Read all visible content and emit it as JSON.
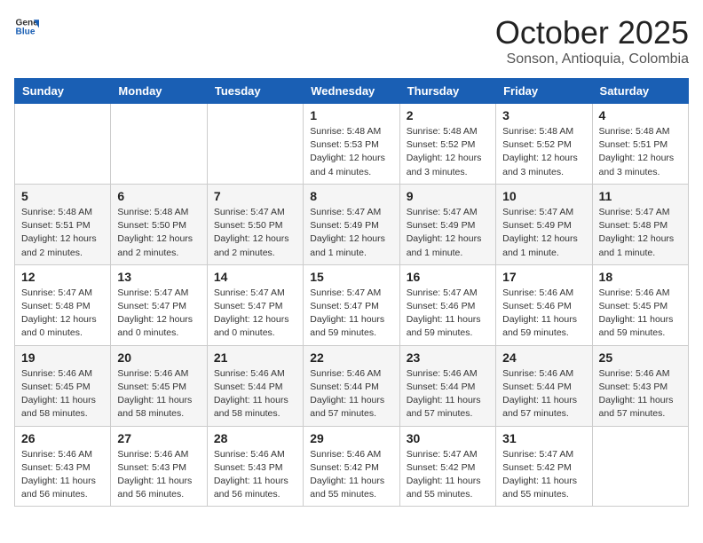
{
  "header": {
    "logo_general": "General",
    "logo_blue": "Blue",
    "title": "October 2025",
    "location": "Sonson, Antioquia, Colombia"
  },
  "days_of_week": [
    "Sunday",
    "Monday",
    "Tuesday",
    "Wednesday",
    "Thursday",
    "Friday",
    "Saturday"
  ],
  "weeks": [
    [
      {
        "day": "",
        "info": ""
      },
      {
        "day": "",
        "info": ""
      },
      {
        "day": "",
        "info": ""
      },
      {
        "day": "1",
        "info": "Sunrise: 5:48 AM\nSunset: 5:53 PM\nDaylight: 12 hours\nand 4 minutes."
      },
      {
        "day": "2",
        "info": "Sunrise: 5:48 AM\nSunset: 5:52 PM\nDaylight: 12 hours\nand 3 minutes."
      },
      {
        "day": "3",
        "info": "Sunrise: 5:48 AM\nSunset: 5:52 PM\nDaylight: 12 hours\nand 3 minutes."
      },
      {
        "day": "4",
        "info": "Sunrise: 5:48 AM\nSunset: 5:51 PM\nDaylight: 12 hours\nand 3 minutes."
      }
    ],
    [
      {
        "day": "5",
        "info": "Sunrise: 5:48 AM\nSunset: 5:51 PM\nDaylight: 12 hours\nand 2 minutes."
      },
      {
        "day": "6",
        "info": "Sunrise: 5:48 AM\nSunset: 5:50 PM\nDaylight: 12 hours\nand 2 minutes."
      },
      {
        "day": "7",
        "info": "Sunrise: 5:47 AM\nSunset: 5:50 PM\nDaylight: 12 hours\nand 2 minutes."
      },
      {
        "day": "8",
        "info": "Sunrise: 5:47 AM\nSunset: 5:49 PM\nDaylight: 12 hours\nand 1 minute."
      },
      {
        "day": "9",
        "info": "Sunrise: 5:47 AM\nSunset: 5:49 PM\nDaylight: 12 hours\nand 1 minute."
      },
      {
        "day": "10",
        "info": "Sunrise: 5:47 AM\nSunset: 5:49 PM\nDaylight: 12 hours\nand 1 minute."
      },
      {
        "day": "11",
        "info": "Sunrise: 5:47 AM\nSunset: 5:48 PM\nDaylight: 12 hours\nand 1 minute."
      }
    ],
    [
      {
        "day": "12",
        "info": "Sunrise: 5:47 AM\nSunset: 5:48 PM\nDaylight: 12 hours\nand 0 minutes."
      },
      {
        "day": "13",
        "info": "Sunrise: 5:47 AM\nSunset: 5:47 PM\nDaylight: 12 hours\nand 0 minutes."
      },
      {
        "day": "14",
        "info": "Sunrise: 5:47 AM\nSunset: 5:47 PM\nDaylight: 12 hours\nand 0 minutes."
      },
      {
        "day": "15",
        "info": "Sunrise: 5:47 AM\nSunset: 5:47 PM\nDaylight: 11 hours\nand 59 minutes."
      },
      {
        "day": "16",
        "info": "Sunrise: 5:47 AM\nSunset: 5:46 PM\nDaylight: 11 hours\nand 59 minutes."
      },
      {
        "day": "17",
        "info": "Sunrise: 5:46 AM\nSunset: 5:46 PM\nDaylight: 11 hours\nand 59 minutes."
      },
      {
        "day": "18",
        "info": "Sunrise: 5:46 AM\nSunset: 5:45 PM\nDaylight: 11 hours\nand 59 minutes."
      }
    ],
    [
      {
        "day": "19",
        "info": "Sunrise: 5:46 AM\nSunset: 5:45 PM\nDaylight: 11 hours\nand 58 minutes."
      },
      {
        "day": "20",
        "info": "Sunrise: 5:46 AM\nSunset: 5:45 PM\nDaylight: 11 hours\nand 58 minutes."
      },
      {
        "day": "21",
        "info": "Sunrise: 5:46 AM\nSunset: 5:44 PM\nDaylight: 11 hours\nand 58 minutes."
      },
      {
        "day": "22",
        "info": "Sunrise: 5:46 AM\nSunset: 5:44 PM\nDaylight: 11 hours\nand 57 minutes."
      },
      {
        "day": "23",
        "info": "Sunrise: 5:46 AM\nSunset: 5:44 PM\nDaylight: 11 hours\nand 57 minutes."
      },
      {
        "day": "24",
        "info": "Sunrise: 5:46 AM\nSunset: 5:44 PM\nDaylight: 11 hours\nand 57 minutes."
      },
      {
        "day": "25",
        "info": "Sunrise: 5:46 AM\nSunset: 5:43 PM\nDaylight: 11 hours\nand 57 minutes."
      }
    ],
    [
      {
        "day": "26",
        "info": "Sunrise: 5:46 AM\nSunset: 5:43 PM\nDaylight: 11 hours\nand 56 minutes."
      },
      {
        "day": "27",
        "info": "Sunrise: 5:46 AM\nSunset: 5:43 PM\nDaylight: 11 hours\nand 56 minutes."
      },
      {
        "day": "28",
        "info": "Sunrise: 5:46 AM\nSunset: 5:43 PM\nDaylight: 11 hours\nand 56 minutes."
      },
      {
        "day": "29",
        "info": "Sunrise: 5:46 AM\nSunset: 5:42 PM\nDaylight: 11 hours\nand 55 minutes."
      },
      {
        "day": "30",
        "info": "Sunrise: 5:47 AM\nSunset: 5:42 PM\nDaylight: 11 hours\nand 55 minutes."
      },
      {
        "day": "31",
        "info": "Sunrise: 5:47 AM\nSunset: 5:42 PM\nDaylight: 11 hours\nand 55 minutes."
      },
      {
        "day": "",
        "info": ""
      }
    ]
  ]
}
